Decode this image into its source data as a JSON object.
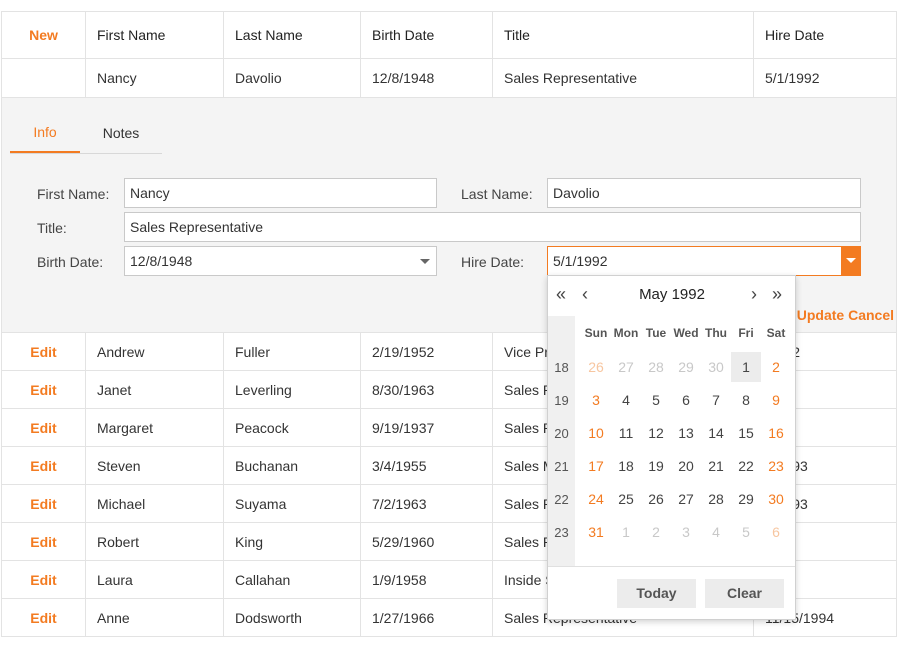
{
  "header": {
    "new_label": "New",
    "columns": [
      "First Name",
      "Last Name",
      "Birth Date",
      "Title",
      "Hire Date"
    ]
  },
  "editing_row": {
    "first": "Nancy",
    "last": "Davolio",
    "birth": "12/8/1948",
    "title": "Sales Representative",
    "hire": "5/1/1992"
  },
  "form": {
    "tabs": [
      "Info",
      "Notes"
    ],
    "labels": {
      "first": "First Name:",
      "last": "Last Name:",
      "title": "Title:",
      "birth": "Birth Date:",
      "hire": "Hire Date:"
    },
    "values": {
      "first": "Nancy",
      "last": "Davolio",
      "title": "Sales Representative",
      "birth": "12/8/1948",
      "hire": "5/1/1992"
    },
    "update_label": "Update",
    "cancel_label": "Cancel"
  },
  "rows": [
    {
      "action": "Edit",
      "first": "Andrew",
      "last": "Fuller",
      "birth": "2/19/1952",
      "title": "Vice Pre",
      "hire": "/1992"
    },
    {
      "action": "Edit",
      "first": "Janet",
      "last": "Leverling",
      "birth": "8/30/1963",
      "title": "Sales R",
      "hire": "992"
    },
    {
      "action": "Edit",
      "first": "Margaret",
      "last": "Peacock",
      "birth": "9/19/1937",
      "title": "Sales R",
      "hire": "993"
    },
    {
      "action": "Edit",
      "first": "Steven",
      "last": "Buchanan",
      "birth": "3/4/1955",
      "title": "Sales M",
      "hire": "7/1993"
    },
    {
      "action": "Edit",
      "first": "Michael",
      "last": "Suyama",
      "birth": "7/2/1963",
      "title": "Sales R",
      "hire": "7/1993"
    },
    {
      "action": "Edit",
      "first": "Robert",
      "last": "King",
      "birth": "5/29/1960",
      "title": "Sales R",
      "hire": "994"
    },
    {
      "action": "Edit",
      "first": "Laura",
      "last": "Callahan",
      "birth": "1/9/1958",
      "title": "Inside S",
      "hire": "994"
    },
    {
      "action": "Edit",
      "first": "Anne",
      "last": "Dodsworth",
      "birth": "1/27/1966",
      "title": "Sales Representative",
      "hire": "11/15/1994"
    }
  ],
  "calendar": {
    "nav_prev_prev": "«",
    "nav_prev": "‹",
    "nav_next": "›",
    "nav_next_next": "»",
    "month_title": "May 1992",
    "weekdays": [
      "Sun",
      "Mon",
      "Tue",
      "Wed",
      "Thu",
      "Fri",
      "Sat"
    ],
    "weeks": [
      {
        "num": "18",
        "days": [
          [
            "26",
            "o"
          ],
          [
            "27",
            "o"
          ],
          [
            "28",
            "o"
          ],
          [
            "29",
            "o"
          ],
          [
            "30",
            "o"
          ],
          [
            "1",
            "s"
          ],
          [
            "2",
            ""
          ]
        ]
      },
      {
        "num": "19",
        "days": [
          [
            "3",
            ""
          ],
          [
            "4",
            ""
          ],
          [
            "5",
            ""
          ],
          [
            "6",
            ""
          ],
          [
            "7",
            ""
          ],
          [
            "8",
            ""
          ],
          [
            "9",
            ""
          ]
        ]
      },
      {
        "num": "20",
        "days": [
          [
            "10",
            ""
          ],
          [
            "11",
            ""
          ],
          [
            "12",
            ""
          ],
          [
            "13",
            ""
          ],
          [
            "14",
            ""
          ],
          [
            "15",
            ""
          ],
          [
            "16",
            ""
          ]
        ]
      },
      {
        "num": "21",
        "days": [
          [
            "17",
            ""
          ],
          [
            "18",
            ""
          ],
          [
            "19",
            ""
          ],
          [
            "20",
            ""
          ],
          [
            "21",
            ""
          ],
          [
            "22",
            ""
          ],
          [
            "23",
            ""
          ]
        ]
      },
      {
        "num": "22",
        "days": [
          [
            "24",
            ""
          ],
          [
            "25",
            ""
          ],
          [
            "26",
            ""
          ],
          [
            "27",
            ""
          ],
          [
            "28",
            ""
          ],
          [
            "29",
            ""
          ],
          [
            "30",
            ""
          ]
        ]
      },
      {
        "num": "23",
        "days": [
          [
            "31",
            ""
          ],
          [
            "1",
            "o"
          ],
          [
            "2",
            "o"
          ],
          [
            "3",
            "o"
          ],
          [
            "4",
            "o"
          ],
          [
            "5",
            "o"
          ],
          [
            "6",
            "o"
          ]
        ]
      }
    ],
    "today_label": "Today",
    "clear_label": "Clear"
  },
  "colors": {
    "accent": "#f37b21"
  }
}
